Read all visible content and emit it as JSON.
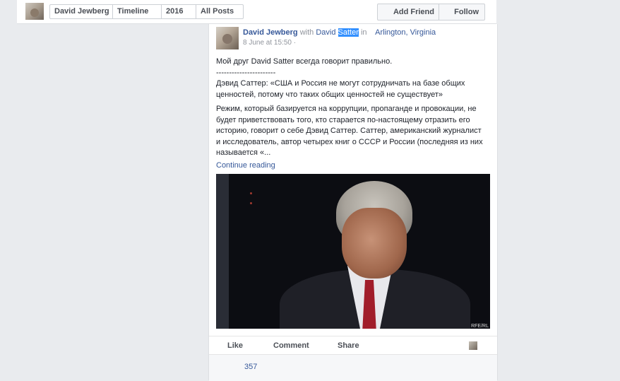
{
  "topbar": {
    "crumbs": [
      "David Jewberg",
      "Timeline",
      "2016",
      "All Posts"
    ],
    "add_friend": "Add Friend",
    "follow": "Follow"
  },
  "post": {
    "author": "David Jewberg",
    "with_word": "with",
    "tagged_first": "David",
    "tagged_second": "Satter",
    "in_word": "in",
    "location": "Arlington, Virginia",
    "timestamp": "8 June at 15:50",
    "privacy_sep": "·",
    "line1": "Мой друг David Satter всегда говорит правильно.",
    "line2": "-----------------------",
    "quote": "Дэвид Саттер: «США и Россия не могут сотрудничать на базе общих ценностей, потому что таких общих ценностей не существует»",
    "paragraph": "Режим, который базируется на коррупции, пропаганде и провокации, не будет приветствовать того, кто старается по-настоящему отразить его историю, говорит о себе Дэвид Саттер. Саттер, американский журналист и исследователь, автор четырех книг о СССР и России (последняя из них называется «...",
    "continue_reading": "Continue reading",
    "video_logo": "RFE/RL",
    "actions": {
      "like": "Like",
      "comment": "Comment",
      "share": "Share"
    },
    "reaction_count": "357"
  },
  "icons": {
    "avatar": "profile-photo",
    "actor_thumb": "profile-photo-small"
  }
}
